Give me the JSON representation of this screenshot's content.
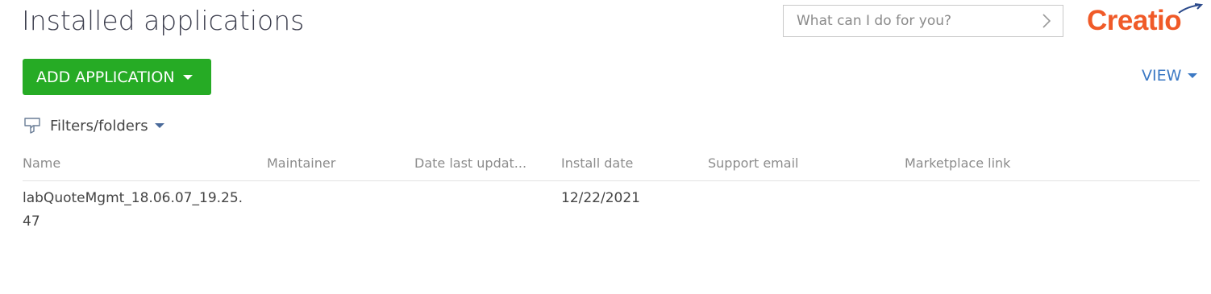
{
  "page": {
    "title": "Installed applications"
  },
  "search": {
    "placeholder": "What can I do for you?"
  },
  "logo": {
    "text": "Creatio",
    "color": "#f05a28"
  },
  "toolbar": {
    "add_application_label": "ADD APPLICATION",
    "add_application_color": "#26ab25",
    "view_label": "VIEW",
    "view_color": "#3c79c4"
  },
  "filters": {
    "label": "Filters/folders"
  },
  "grid": {
    "columns": [
      "Name",
      "Maintainer",
      "Date last updat...",
      "Install date",
      "Support email",
      "Marketplace link"
    ],
    "rows": [
      {
        "name": "labQuoteMgmt_18.06.07_19.25.47",
        "maintainer": "",
        "date_last_updated": "",
        "install_date": "12/22/2021",
        "support_email": "",
        "marketplace_link": ""
      }
    ]
  }
}
